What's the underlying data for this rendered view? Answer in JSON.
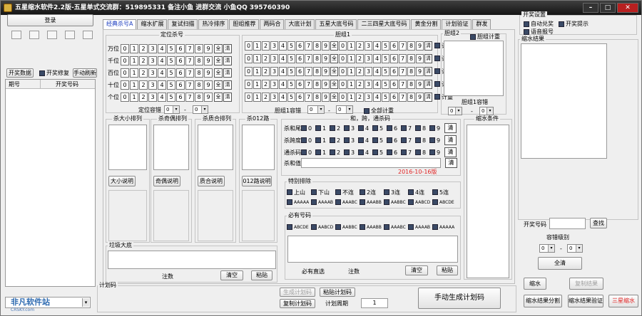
{
  "title": "五星缩水软件2.2版-五星单式交流群：519895331 备注小鱼 进群交流  小鱼QQ 395760390",
  "window_controls": {
    "min": "–",
    "max": "□",
    "close": "✕"
  },
  "left": {
    "login": "登录",
    "lottery_data": "开奖数据",
    "fix_label": "开奖修复",
    "refresh": "手动刷新",
    "col_issue": "期号",
    "col_number": "开奖号码"
  },
  "tabs": [
    "经典杀号A",
    "缩水扩展",
    "复试扫描",
    "热冷排序",
    "胆组推荐",
    "两码合",
    "大底计划",
    "五星大底号码",
    "二三四星大底号码",
    "黄金分割",
    "计划验证",
    "群发"
  ],
  "kill": {
    "title": "定位杀号",
    "rows": [
      "万位",
      "千位",
      "百位",
      "十位",
      "个位"
    ],
    "digits": [
      "0",
      "1",
      "2",
      "3",
      "4",
      "5",
      "6",
      "7",
      "8",
      "9"
    ],
    "all": "全",
    "clear": "清",
    "fault_label": "定位容错",
    "fault_from": "0",
    "fault_to": "0",
    "dash": "-"
  },
  "dan": {
    "title": "胆组1",
    "calc": "计重",
    "fault_label": "胆组1容错",
    "fault_from": "0",
    "fault_to": "0",
    "all_calc": "全部计重"
  },
  "dan2": {
    "title": "胆组2",
    "calc": "胆组计重",
    "fault_label": "胆组1容错",
    "fault_from": "0",
    "fault_to": "0"
  },
  "kill_groups": [
    {
      "title": "杀大小排列",
      "btn": "大小说明"
    },
    {
      "title": "杀奇偶排列",
      "btn": "奇偶说明"
    },
    {
      "title": "杀质合排列",
      "btn": "质合说明"
    },
    {
      "title": "杀012路",
      "btn": "012路说明"
    }
  ],
  "sum": {
    "title": "和，跨，通杀码",
    "rows": [
      "杀和尾",
      "杀跨度",
      "通杀码"
    ],
    "digits": [
      "0",
      "1",
      "2",
      "3",
      "4",
      "5",
      "6",
      "7",
      "8",
      "9"
    ],
    "clear": "清",
    "sum_value": "杀和值",
    "date": "2016-10-16版"
  },
  "special": {
    "title": "特别排除",
    "row1": [
      "上山",
      "下山",
      "不连",
      "2连",
      "3连",
      "4连",
      "5连"
    ],
    "row2": [
      "AAAAA",
      "AAAAB",
      "AAABC",
      "AAABB",
      "AABBC",
      "AABCD",
      "ABCDE"
    ]
  },
  "must": {
    "title": "必有号码",
    "items": [
      "ABCDE",
      "AABCD",
      "AABBC",
      "AAABB",
      "AAABC",
      "AAAAB",
      "AAAAA"
    ],
    "has_include": "必有直选",
    "note": "注数",
    "clear": "清空",
    "paste": "粘贴"
  },
  "garbage": {
    "title": "垃圾大底",
    "note": "注数",
    "clear": "清空",
    "paste": "粘贴"
  },
  "shrink_cond": "缩水条件",
  "plan": {
    "title": "计划码",
    "gen": "生成计划码",
    "paste": "粘贴计划码",
    "copy": "复制计划码",
    "cycle": "计划周期",
    "cycle_value": "1",
    "manual": "手动生成计划码"
  },
  "right": {
    "settings": "开奖设置",
    "auto_redeem": "自动兑奖",
    "prompt": "开奖提示",
    "voice": "语音报号",
    "result": "缩水结果",
    "lottery_no": "开奖号码",
    "check": "查找",
    "fault_level": "容错级别",
    "fault_from": "0",
    "fault_to": "0",
    "all_clear": "全清",
    "shrink": "缩水",
    "copy_result": "复制结果",
    "split": "缩水结果分割",
    "verify": "缩水结果验证",
    "three_star": "三星缩水"
  },
  "watermark": "非凡软件站",
  "watermark_sub": "CRSKY.com"
}
